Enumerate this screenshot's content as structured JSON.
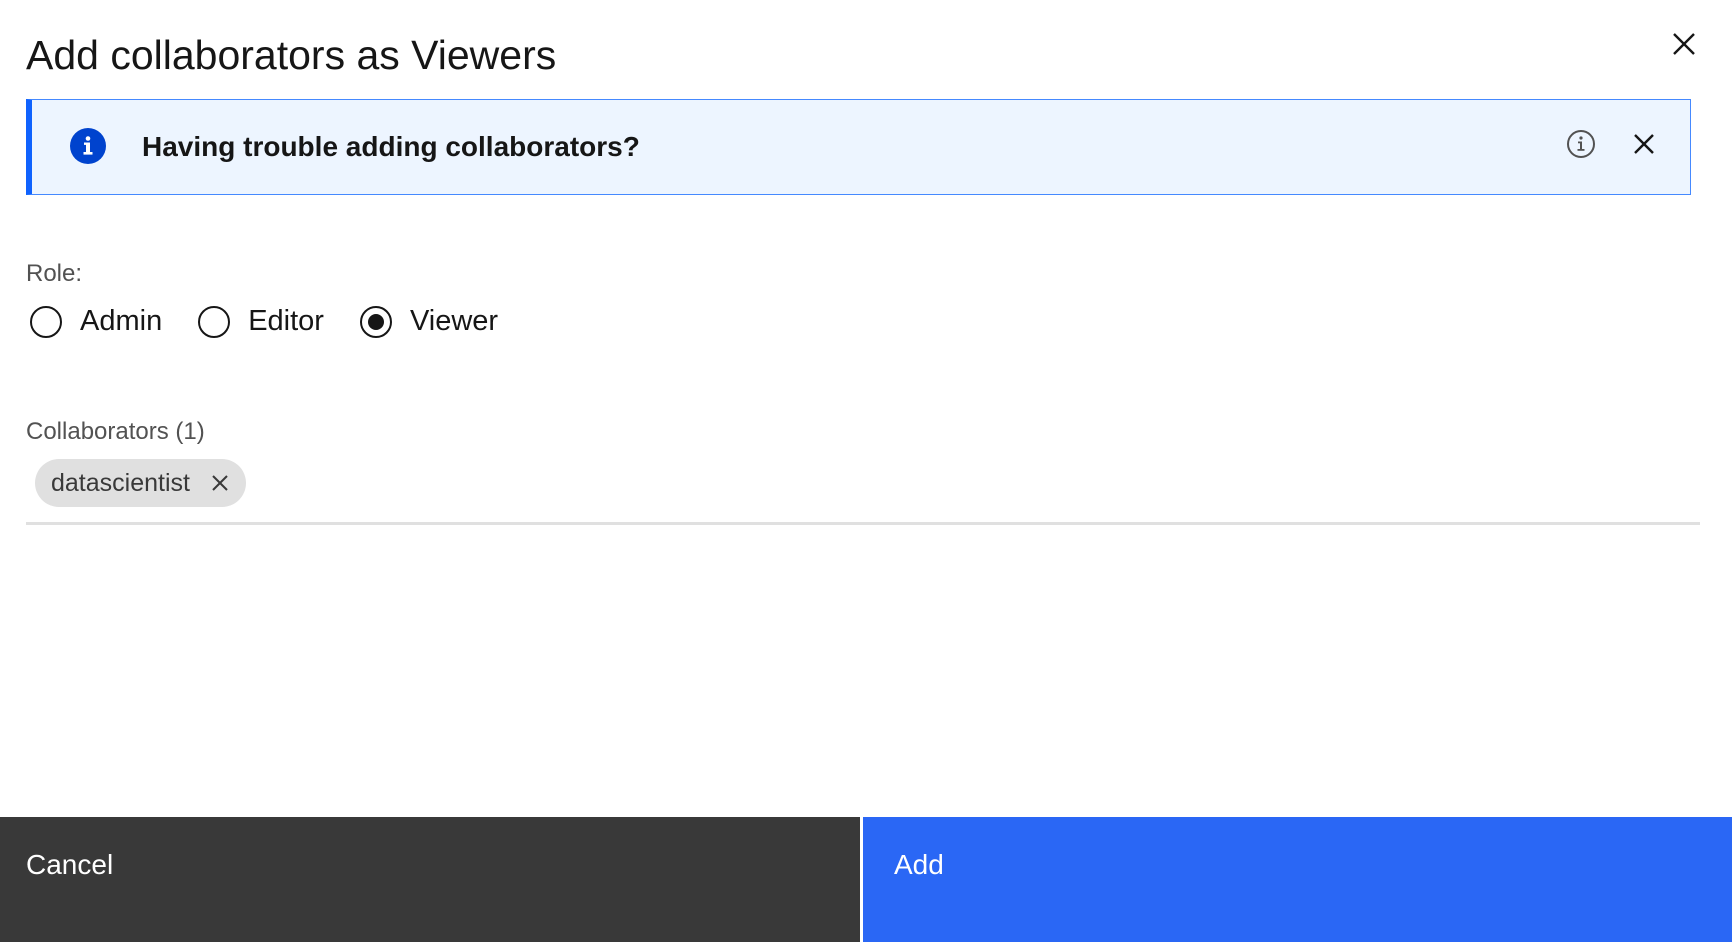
{
  "modal": {
    "title": "Add collaborators as Viewers"
  },
  "notification": {
    "title": "Having trouble adding collaborators?",
    "kind": "info",
    "accent_color": "#0f62fe",
    "background_color": "#edf5ff",
    "icons": {
      "status": "info-filled-icon",
      "info": "info-outline-icon",
      "close": "close-icon"
    }
  },
  "role": {
    "label": "Role:",
    "options": [
      {
        "label": "Admin",
        "selected": false
      },
      {
        "label": "Editor",
        "selected": false
      },
      {
        "label": "Viewer",
        "selected": true
      }
    ]
  },
  "collaborators": {
    "label": "Collaborators (1)",
    "tags": [
      "datascientist"
    ]
  },
  "footer": {
    "cancel_label": "Cancel",
    "add_label": "Add",
    "cancel_color": "#393939",
    "add_color": "#2a67f5"
  }
}
